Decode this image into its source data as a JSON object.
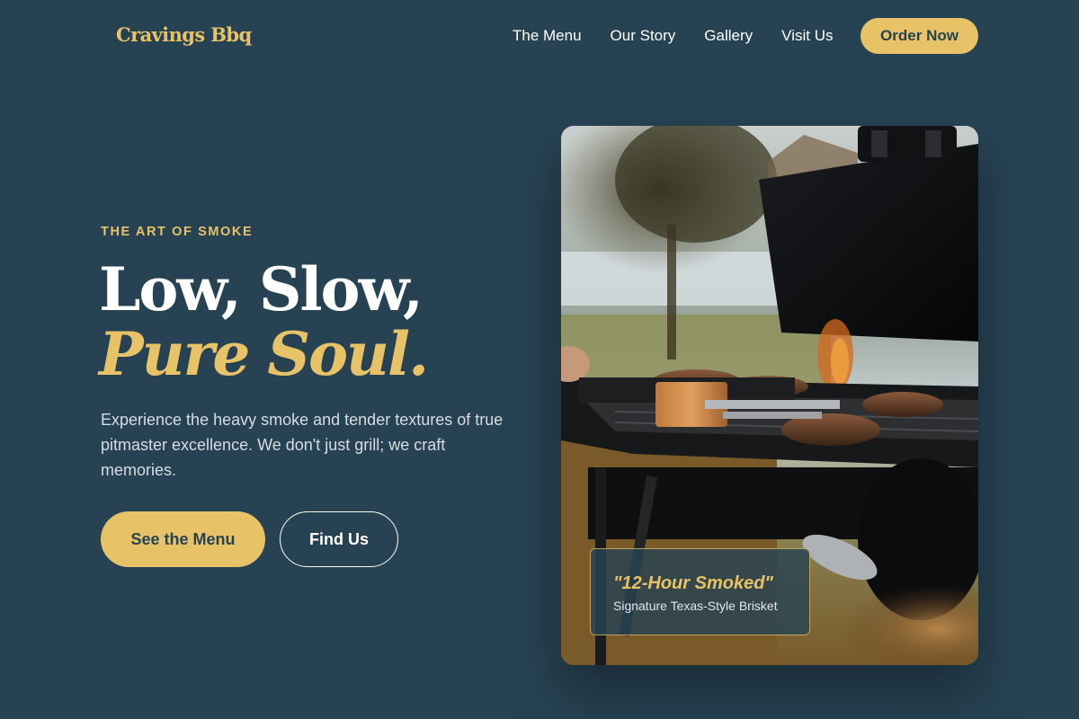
{
  "header": {
    "logo": "Cravings Bbq",
    "nav": [
      "The Menu",
      "Our Story",
      "Gallery",
      "Visit Us"
    ],
    "cta_label": "Order Now"
  },
  "hero": {
    "eyebrow": "THE ART OF SMOKE",
    "headline_line1": "Low, Slow,",
    "headline_line2": "Pure Soul.",
    "description": "Experience the heavy smoke and tender textures of true pitmaster excellence. We don't just grill; we craft memories.",
    "primary_button": "See the Menu",
    "secondary_button": "Find Us"
  },
  "photo_card": {
    "caption_title": "\"12-Hour Smoked\"",
    "caption_subtitle": "Signature Texas-Style Brisket"
  },
  "colors": {
    "background": "#274353",
    "accent": "#e8c267",
    "text": "#ffffff"
  }
}
